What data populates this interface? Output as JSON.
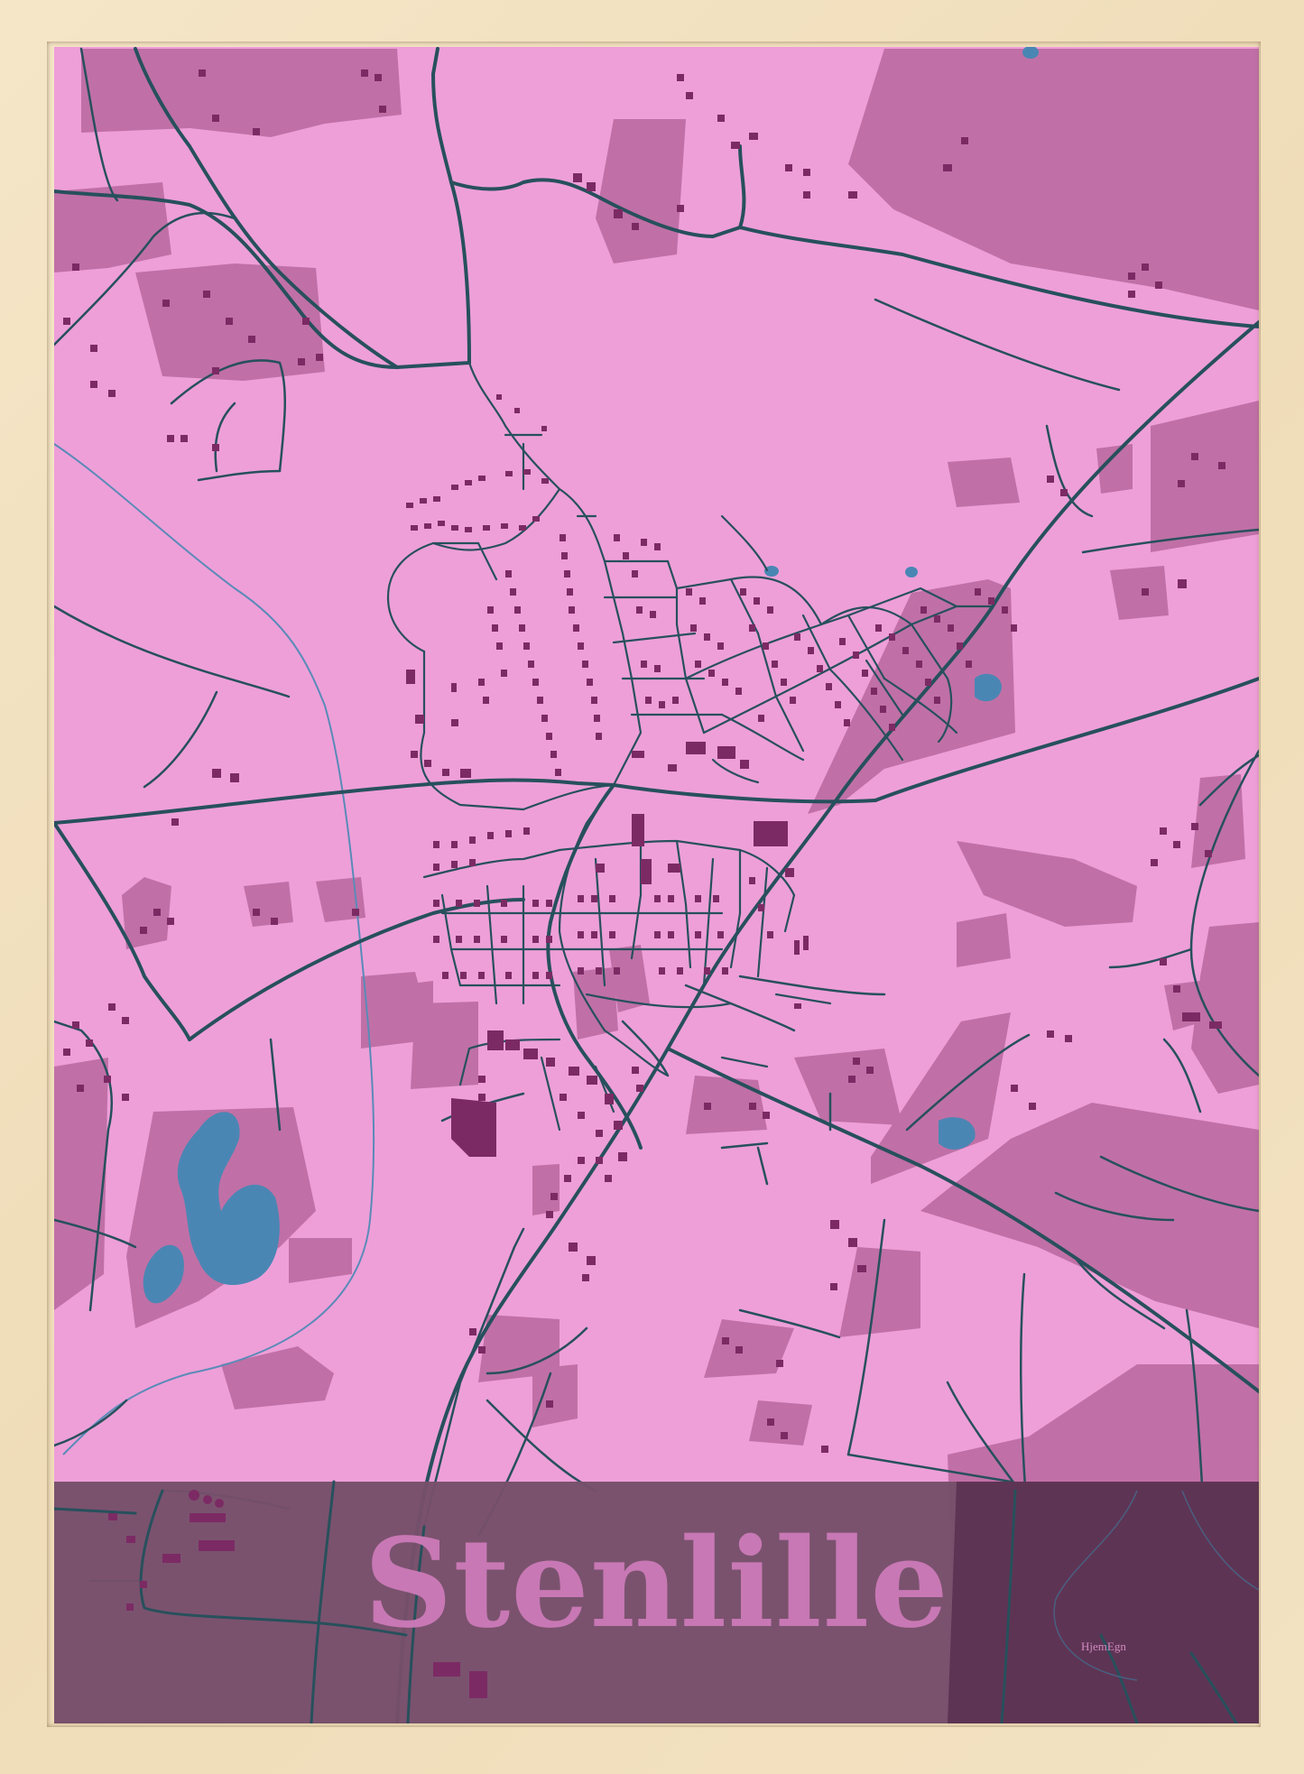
{
  "poster": {
    "city_name": "Stenlille",
    "brand": "HjemEgn"
  },
  "colors": {
    "frame": "#f3e2c2",
    "background": "#ee9fd8",
    "fields": "#c070a6",
    "buildings": "#7c2a64",
    "roads": "#27505c",
    "water": "#4a86b4",
    "stream": "#5a8ab8",
    "banner": "#76506a",
    "banner_dark": "#5e3454",
    "title": "#c878b4"
  },
  "map_layers": [
    "fields",
    "water",
    "roads",
    "buildings",
    "label-banner"
  ]
}
